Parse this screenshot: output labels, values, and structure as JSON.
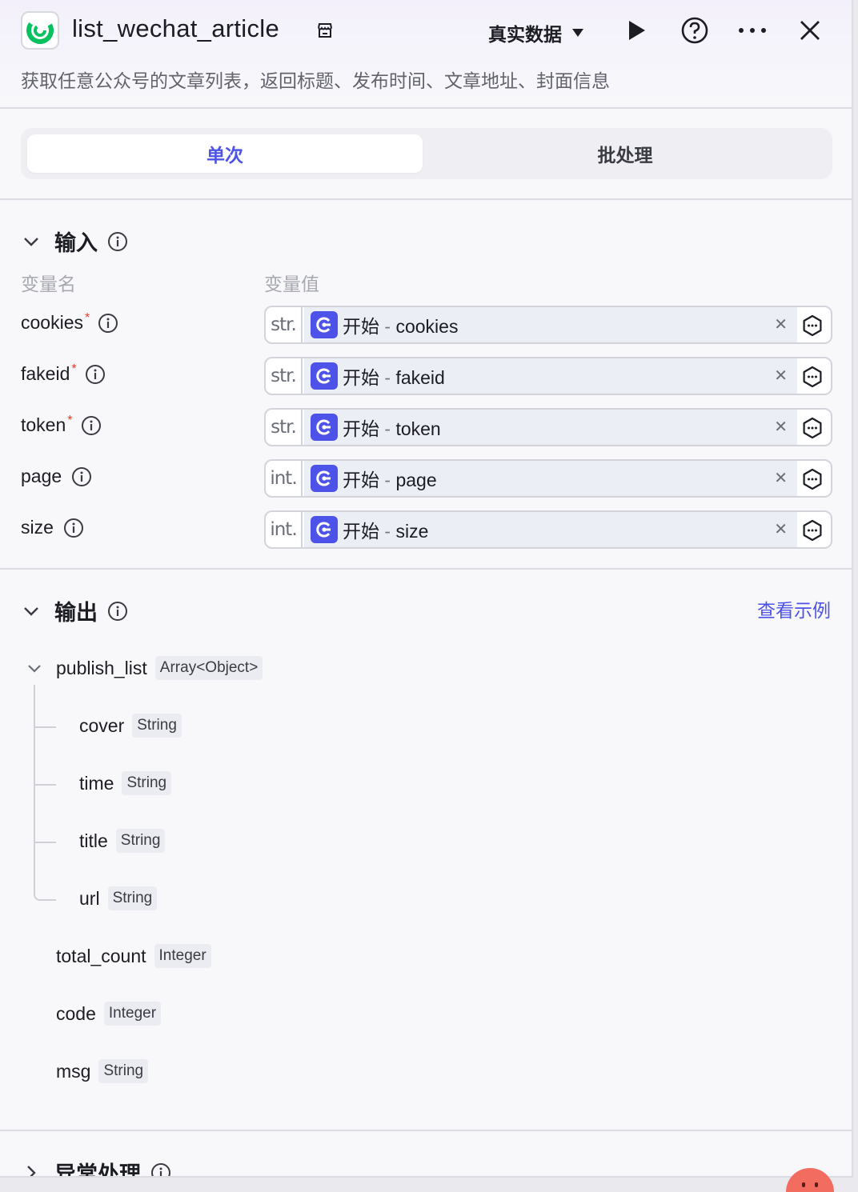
{
  "header": {
    "title": "list_wechat_article",
    "description": "获取任意公众号的文章列表，返回标题、发布时间、文章地址、封面信息",
    "mode_select": "真实数据",
    "icons": [
      "wechat-logo",
      "store-icon",
      "play-icon",
      "help-icon",
      "more-icon",
      "close-icon"
    ]
  },
  "tabs": [
    {
      "label": "单次",
      "active": true
    },
    {
      "label": "批处理",
      "active": false
    }
  ],
  "input": {
    "title": "输入",
    "col_name": "变量名",
    "col_value": "变量值",
    "rows": [
      {
        "name": "cookies",
        "required": "*",
        "type": "str.",
        "source": "开始",
        "sep": "-",
        "field": "cookies"
      },
      {
        "name": "fakeid",
        "required": "*",
        "type": "str.",
        "source": "开始",
        "sep": "-",
        "field": "fakeid"
      },
      {
        "name": "token",
        "required": "*",
        "type": "str.",
        "source": "开始",
        "sep": "-",
        "field": "token"
      },
      {
        "name": "page",
        "required": "",
        "type": "int.",
        "source": "开始",
        "sep": "-",
        "field": "page"
      },
      {
        "name": "size",
        "required": "",
        "type": "int.",
        "source": "开始",
        "sep": "-",
        "field": "size"
      }
    ]
  },
  "output": {
    "title": "输出",
    "view_example": "查看示例",
    "items": [
      {
        "name": "publish_list",
        "type": "Array<Object>"
      },
      {
        "name": "cover",
        "type": "String"
      },
      {
        "name": "time",
        "type": "String"
      },
      {
        "name": "title",
        "type": "String"
      },
      {
        "name": "url",
        "type": "String"
      },
      {
        "name": "total_count",
        "type": "Integer"
      },
      {
        "name": "code",
        "type": "Integer"
      },
      {
        "name": "msg",
        "type": "String"
      }
    ]
  },
  "exception": {
    "title": "异常处理"
  },
  "colors": {
    "accent": "#4d53e8",
    "required": "#f93920",
    "logo_green": "#07c160"
  }
}
